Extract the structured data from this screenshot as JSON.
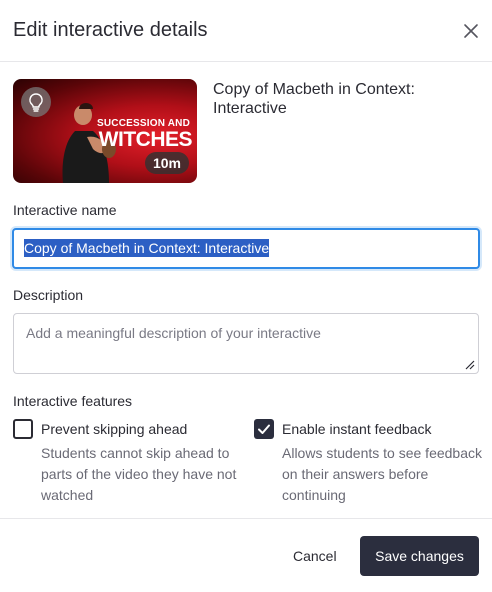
{
  "dialog": {
    "title": "Edit interactive details",
    "close_icon": "close-icon"
  },
  "video": {
    "title": "Copy of Macbeth in Context: Interactive",
    "thumbnail": {
      "overlay_icon": "lightbulb-icon",
      "line1": "SUCCESSION AND",
      "line2": "WITCHES",
      "duration": "10m"
    }
  },
  "form": {
    "name_label": "Interactive name",
    "name_value": "Copy of Macbeth in Context: Interactive",
    "description_label": "Description",
    "description_placeholder": "Add a meaningful description of your interactive",
    "features_label": "Interactive features",
    "features": [
      {
        "title": "Prevent skipping ahead",
        "description": "Students cannot skip ahead to parts of the video they have not watched",
        "checked": false
      },
      {
        "title": "Enable instant feedback",
        "description": "Allows students to see feedback on their answers before continuing",
        "checked": true
      }
    ]
  },
  "footer": {
    "cancel_label": "Cancel",
    "save_label": "Save changes"
  },
  "colors": {
    "primary_button": "#2b2e3e",
    "focus_ring": "#2f8ae6",
    "selection": "#2c5fc4"
  }
}
